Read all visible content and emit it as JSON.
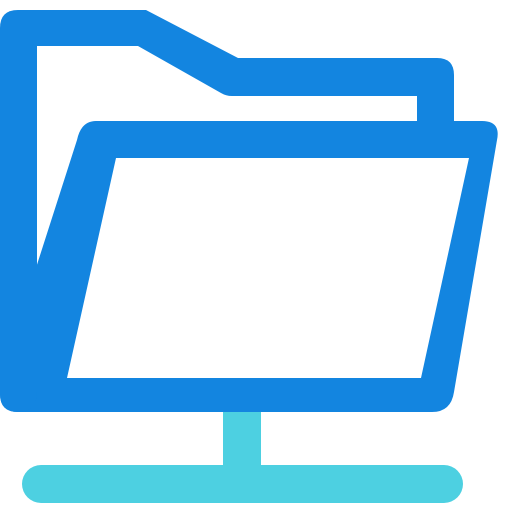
{
  "icon": {
    "name": "network-folder-icon",
    "colors": {
      "folder": "#1385E0",
      "network": "#4DD0E1",
      "background": "#FFFFFF"
    }
  }
}
